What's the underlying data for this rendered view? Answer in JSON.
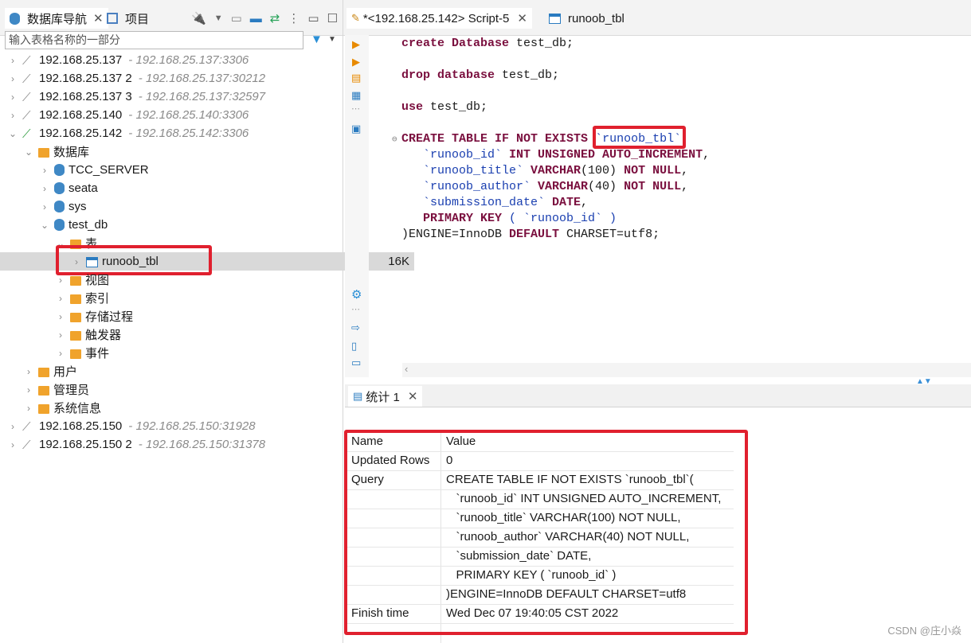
{
  "left_tabs": {
    "navigator": "数据库导航",
    "project": "项目"
  },
  "filter": {
    "placeholder": "输入表格名称的一部分"
  },
  "tree": [
    {
      "label": "192.168.25.137",
      "sub": "- 192.168.25.137:3306"
    },
    {
      "label": "192.168.25.137 2",
      "sub": "- 192.168.25.137:30212"
    },
    {
      "label": "192.168.25.137 3",
      "sub": "- 192.168.25.137:32597"
    },
    {
      "label": "192.168.25.140",
      "sub": "- 192.168.25.140:3306"
    },
    {
      "label": "192.168.25.142",
      "sub": "- 192.168.25.142:3306"
    },
    {
      "label": "数据库"
    },
    {
      "label": "TCC_SERVER"
    },
    {
      "label": "seata"
    },
    {
      "label": "sys"
    },
    {
      "label": "test_db"
    },
    {
      "label": "表"
    },
    {
      "label": "runoob_tbl",
      "size": "16K"
    },
    {
      "label": "视图"
    },
    {
      "label": "索引"
    },
    {
      "label": "存储过程"
    },
    {
      "label": "触发器"
    },
    {
      "label": "事件"
    },
    {
      "label": "用户"
    },
    {
      "label": "管理员"
    },
    {
      "label": "系统信息"
    },
    {
      "label": "192.168.25.150",
      "sub": "- 192.168.25.150:31928"
    },
    {
      "label": "192.168.25.150 2",
      "sub": "- 192.168.25.150:31378"
    }
  ],
  "editor_tabs": {
    "script": "*<192.168.25.142> Script-5",
    "table": "runoob_tbl"
  },
  "code": {
    "l1a": "create",
    "l1b": "Database",
    "l1c": " test_db;",
    "l2a": "drop",
    "l2b": "database",
    "l2c": " test_db;",
    "l3a": "use",
    "l3c": " test_db;",
    "l4a": "CREATE TABLE IF NOT EXISTS",
    "l4b": "`runoob_tbl`",
    "l5a": "   `runoob_id` ",
    "l5b": "INT UNSIGNED AUTO_INCREMENT",
    "l6a": "   `runoob_title` ",
    "l6b": "VARCHAR",
    "l6c": "(100) ",
    "l6d": "NOT NULL",
    "l7a": "   `runoob_author` ",
    "l7b": "VARCHAR",
    "l7c": "(40) ",
    "l7d": "NOT NULL",
    "l8a": "   `submission_date` ",
    "l8b": "DATE",
    "l9a": "   PRIMARY KEY",
    "l9b": " ( `runoob_id` )",
    "l10a": ")ENGINE",
    "l10b": "=InnoDB ",
    "l10c": "DEFAULT",
    "l10d": " CHARSET=utf8;"
  },
  "results": {
    "tab_label": "统计 1",
    "header": {
      "name": "Name",
      "value": "Value"
    },
    "rows": [
      {
        "name": "Updated Rows",
        "value": "0"
      },
      {
        "name": "Query",
        "value": "CREATE TABLE IF NOT EXISTS `runoob_tbl`("
      },
      {
        "name": "",
        "value": "   `runoob_id` INT UNSIGNED AUTO_INCREMENT,"
      },
      {
        "name": "",
        "value": "   `runoob_title` VARCHAR(100) NOT NULL,"
      },
      {
        "name": "",
        "value": "   `runoob_author` VARCHAR(40) NOT NULL,"
      },
      {
        "name": "",
        "value": "   `submission_date` DATE,"
      },
      {
        "name": "",
        "value": "   PRIMARY KEY ( `runoob_id` )"
      },
      {
        "name": "",
        "value": ")ENGINE=InnoDB DEFAULT CHARSET=utf8"
      },
      {
        "name": "Finish time",
        "value": "Wed Dec 07 19:40:05 CST 2022"
      }
    ]
  },
  "watermark": "CSDN @庄小焱",
  "colors": {
    "highlight_box": "#e0202e",
    "keyword": "#7a0f3e",
    "accent": "#3f88c5"
  }
}
